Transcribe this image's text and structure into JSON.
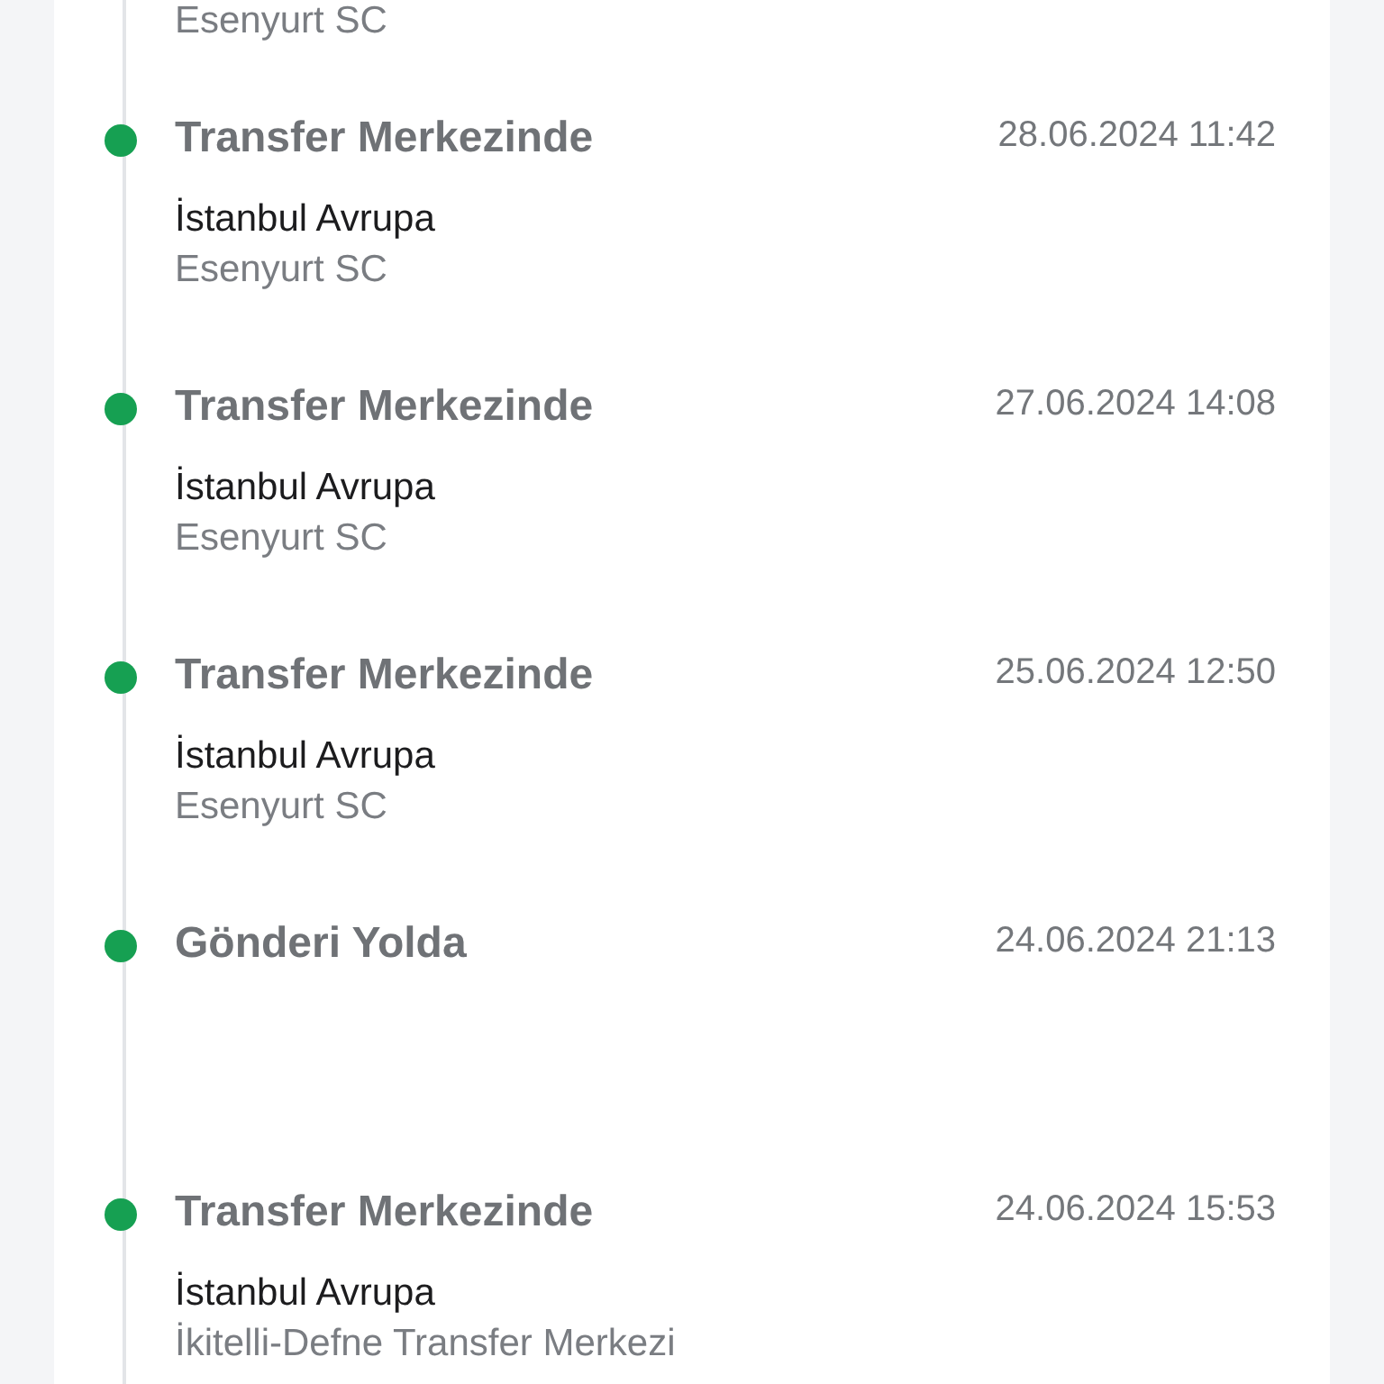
{
  "previous_location": "Esenyurt SC",
  "events": [
    {
      "status": "Transfer Merkezinde",
      "date": "28.06.2024 11:42",
      "city": "İstanbul Avrupa",
      "location": "Esenyurt SC"
    },
    {
      "status": "Transfer Merkezinde",
      "date": "27.06.2024 14:08",
      "city": "İstanbul Avrupa",
      "location": "Esenyurt SC"
    },
    {
      "status": "Transfer Merkezinde",
      "date": "25.06.2024 12:50",
      "city": "İstanbul Avrupa",
      "location": "Esenyurt SC"
    },
    {
      "status": "Gönderi Yolda",
      "date": "24.06.2024 21:13"
    },
    {
      "status": "Transfer Merkezinde",
      "date": "24.06.2024 15:53",
      "city": "İstanbul Avrupa",
      "location": "İkitelli-Defne Transfer Merkezi"
    }
  ]
}
